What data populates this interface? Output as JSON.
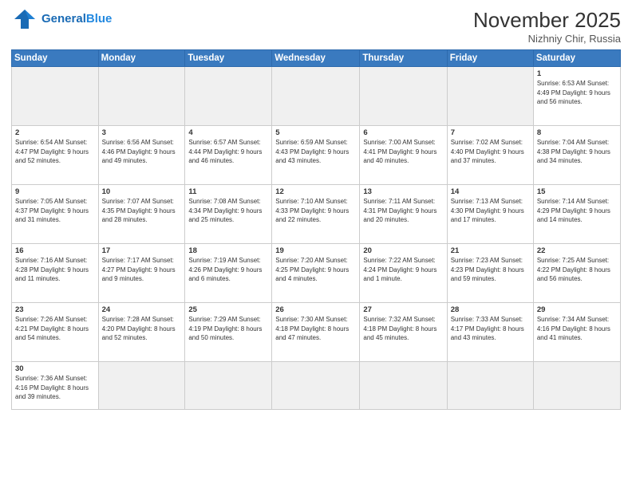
{
  "header": {
    "logo_general": "General",
    "logo_blue": "Blue",
    "month_year": "November 2025",
    "location": "Nizhniy Chir, Russia"
  },
  "days_of_week": [
    "Sunday",
    "Monday",
    "Tuesday",
    "Wednesday",
    "Thursday",
    "Friday",
    "Saturday"
  ],
  "weeks": [
    [
      {
        "day": "",
        "info": ""
      },
      {
        "day": "",
        "info": ""
      },
      {
        "day": "",
        "info": ""
      },
      {
        "day": "",
        "info": ""
      },
      {
        "day": "",
        "info": ""
      },
      {
        "day": "",
        "info": ""
      },
      {
        "day": "1",
        "info": "Sunrise: 6:53 AM\nSunset: 4:49 PM\nDaylight: 9 hours and 56 minutes."
      }
    ],
    [
      {
        "day": "2",
        "info": "Sunrise: 6:54 AM\nSunset: 4:47 PM\nDaylight: 9 hours and 52 minutes."
      },
      {
        "day": "3",
        "info": "Sunrise: 6:56 AM\nSunset: 4:46 PM\nDaylight: 9 hours and 49 minutes."
      },
      {
        "day": "4",
        "info": "Sunrise: 6:57 AM\nSunset: 4:44 PM\nDaylight: 9 hours and 46 minutes."
      },
      {
        "day": "5",
        "info": "Sunrise: 6:59 AM\nSunset: 4:43 PM\nDaylight: 9 hours and 43 minutes."
      },
      {
        "day": "6",
        "info": "Sunrise: 7:00 AM\nSunset: 4:41 PM\nDaylight: 9 hours and 40 minutes."
      },
      {
        "day": "7",
        "info": "Sunrise: 7:02 AM\nSunset: 4:40 PM\nDaylight: 9 hours and 37 minutes."
      },
      {
        "day": "8",
        "info": "Sunrise: 7:04 AM\nSunset: 4:38 PM\nDaylight: 9 hours and 34 minutes."
      }
    ],
    [
      {
        "day": "9",
        "info": "Sunrise: 7:05 AM\nSunset: 4:37 PM\nDaylight: 9 hours and 31 minutes."
      },
      {
        "day": "10",
        "info": "Sunrise: 7:07 AM\nSunset: 4:35 PM\nDaylight: 9 hours and 28 minutes."
      },
      {
        "day": "11",
        "info": "Sunrise: 7:08 AM\nSunset: 4:34 PM\nDaylight: 9 hours and 25 minutes."
      },
      {
        "day": "12",
        "info": "Sunrise: 7:10 AM\nSunset: 4:33 PM\nDaylight: 9 hours and 22 minutes."
      },
      {
        "day": "13",
        "info": "Sunrise: 7:11 AM\nSunset: 4:31 PM\nDaylight: 9 hours and 20 minutes."
      },
      {
        "day": "14",
        "info": "Sunrise: 7:13 AM\nSunset: 4:30 PM\nDaylight: 9 hours and 17 minutes."
      },
      {
        "day": "15",
        "info": "Sunrise: 7:14 AM\nSunset: 4:29 PM\nDaylight: 9 hours and 14 minutes."
      }
    ],
    [
      {
        "day": "16",
        "info": "Sunrise: 7:16 AM\nSunset: 4:28 PM\nDaylight: 9 hours and 11 minutes."
      },
      {
        "day": "17",
        "info": "Sunrise: 7:17 AM\nSunset: 4:27 PM\nDaylight: 9 hours and 9 minutes."
      },
      {
        "day": "18",
        "info": "Sunrise: 7:19 AM\nSunset: 4:26 PM\nDaylight: 9 hours and 6 minutes."
      },
      {
        "day": "19",
        "info": "Sunrise: 7:20 AM\nSunset: 4:25 PM\nDaylight: 9 hours and 4 minutes."
      },
      {
        "day": "20",
        "info": "Sunrise: 7:22 AM\nSunset: 4:24 PM\nDaylight: 9 hours and 1 minute."
      },
      {
        "day": "21",
        "info": "Sunrise: 7:23 AM\nSunset: 4:23 PM\nDaylight: 8 hours and 59 minutes."
      },
      {
        "day": "22",
        "info": "Sunrise: 7:25 AM\nSunset: 4:22 PM\nDaylight: 8 hours and 56 minutes."
      }
    ],
    [
      {
        "day": "23",
        "info": "Sunrise: 7:26 AM\nSunset: 4:21 PM\nDaylight: 8 hours and 54 minutes."
      },
      {
        "day": "24",
        "info": "Sunrise: 7:28 AM\nSunset: 4:20 PM\nDaylight: 8 hours and 52 minutes."
      },
      {
        "day": "25",
        "info": "Sunrise: 7:29 AM\nSunset: 4:19 PM\nDaylight: 8 hours and 50 minutes."
      },
      {
        "day": "26",
        "info": "Sunrise: 7:30 AM\nSunset: 4:18 PM\nDaylight: 8 hours and 47 minutes."
      },
      {
        "day": "27",
        "info": "Sunrise: 7:32 AM\nSunset: 4:18 PM\nDaylight: 8 hours and 45 minutes."
      },
      {
        "day": "28",
        "info": "Sunrise: 7:33 AM\nSunset: 4:17 PM\nDaylight: 8 hours and 43 minutes."
      },
      {
        "day": "29",
        "info": "Sunrise: 7:34 AM\nSunset: 4:16 PM\nDaylight: 8 hours and 41 minutes."
      }
    ],
    [
      {
        "day": "30",
        "info": "Sunrise: 7:36 AM\nSunset: 4:16 PM\nDaylight: 8 hours and 39 minutes."
      },
      {
        "day": "",
        "info": ""
      },
      {
        "day": "",
        "info": ""
      },
      {
        "day": "",
        "info": ""
      },
      {
        "day": "",
        "info": ""
      },
      {
        "day": "",
        "info": ""
      },
      {
        "day": "",
        "info": ""
      }
    ]
  ]
}
